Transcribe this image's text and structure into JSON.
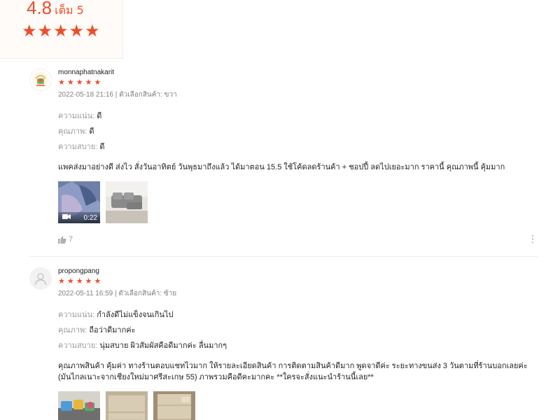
{
  "summary": {
    "score": "4.8",
    "out_of": "เต็ม 5",
    "stars": 5
  },
  "reviews": [
    {
      "username": "monnaphatnakarit",
      "stars": 5,
      "meta": "2022-05-18 21:16 | ตัวเลือกสินค้า: ขวา",
      "attributes": [
        {
          "key": "ความแน่น:",
          "value": "ดี"
        },
        {
          "key": "คุณภาพ:",
          "value": "ดี"
        },
        {
          "key": "ความสบาย:",
          "value": "ดี"
        }
      ],
      "text": "แพคส่งมาอย่างดี ส่งไว สั่งวันอาทิตย์ วันพุธมาถึงแล้ว ได้มาตอน 15.5 ใช้โค้ดลดร้านค้า + ชอปปี้ ลดไปเยอะมาก ราคานี้ คุณภาพนี้ คุ้มมาก",
      "video_duration": "0:22",
      "likes": "7",
      "avatar_icon": "shop-logo-icon"
    },
    {
      "username": "propongpang",
      "stars": 5,
      "meta": "2022-05-11 16:59 | ตัวเลือกสินค้า: ซ้าย",
      "attributes": [
        {
          "key": "ความแน่น:",
          "value": "กำลังดีไม่แข็งจนเกินไป"
        },
        {
          "key": "คุณภาพ:",
          "value": "ถือว่าดีมากค่ะ"
        },
        {
          "key": "ความสบาย:",
          "value": "นุ่มสบาย ผิวสัมผัสคือดีมากค่ะ ลื่นมากๆ"
        }
      ],
      "text": "คุณภาพสินค้า คุ้มค่า ทางร้านตอบแชทไวมาก ให้รายละเอียดสินค้า การติดตามสินค้าดีมาก พูดจาดีค่ะ ระยะทางขนส่ง 3 วันตามที่ร้านบอกเลยค่ะ (มันไกลเนาะจากเชียงใหม่มาศรีสะเกษ 55) ภาพรวมคือดีคะมากคะ **ใครจะสั่งแนะนำร้านนี้เลย**",
      "avatar_icon": "default-user-icon"
    }
  ],
  "colors": {
    "accent": "#ee4d2d",
    "muted": "#9a9a9a"
  }
}
